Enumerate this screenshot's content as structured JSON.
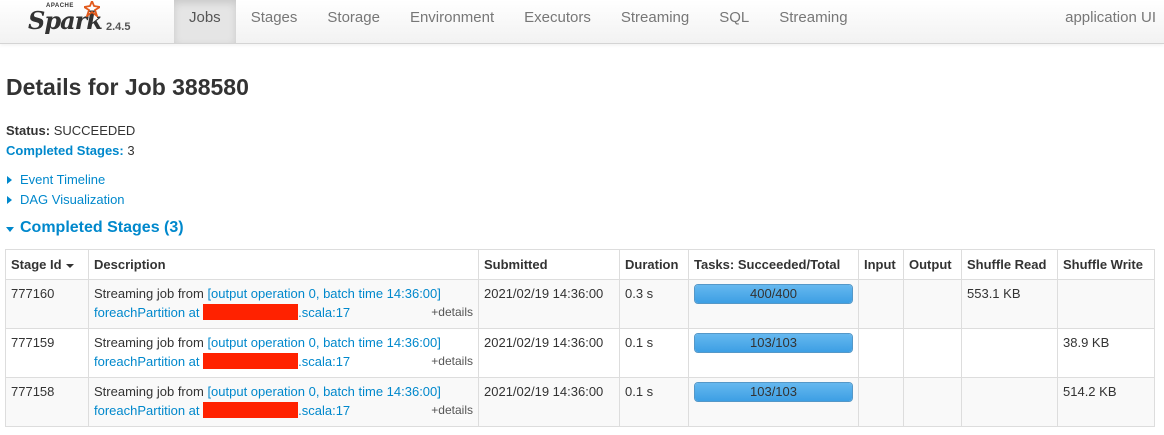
{
  "navbar": {
    "brand": {
      "apache": "APACHE",
      "name": "Spark",
      "version": "2.4.5"
    },
    "tabs": [
      {
        "label": "Jobs",
        "active": true
      },
      {
        "label": "Stages",
        "active": false
      },
      {
        "label": "Storage",
        "active": false
      },
      {
        "label": "Environment",
        "active": false
      },
      {
        "label": "Executors",
        "active": false
      },
      {
        "label": "Streaming",
        "active": false
      },
      {
        "label": "SQL",
        "active": false
      },
      {
        "label": "Streaming",
        "active": false
      }
    ],
    "app_name": "application UI"
  },
  "page": {
    "title": "Details for Job 388580",
    "status_label": "Status:",
    "status_value": "SUCCEEDED",
    "completed_label": "Completed Stages:",
    "completed_value": "3",
    "event_timeline": "Event Timeline",
    "dag_visualization": "DAG Visualization",
    "section_title": "Completed Stages (3)"
  },
  "table": {
    "headers": [
      "Stage Id",
      "Description",
      "Submitted",
      "Duration",
      "Tasks: Succeeded/Total",
      "Input",
      "Output",
      "Shuffle Read",
      "Shuffle Write"
    ],
    "rows": [
      {
        "stage_id": "777160",
        "desc_prefix": "Streaming job from ",
        "desc_link": "[output operation 0, batch time 14:36:00]",
        "desc_line2_prefix": "foreachPartition at ",
        "desc_line2_suffix": ".scala:17",
        "details": "+details",
        "submitted": "2021/02/19 14:36:00",
        "duration": "0.3 s",
        "tasks": "400/400",
        "tasks_fraction": 1.0,
        "input": "",
        "output": "",
        "shuffle_read": "553.1 KB",
        "shuffle_write": ""
      },
      {
        "stage_id": "777159",
        "desc_prefix": "Streaming job from ",
        "desc_link": "[output operation 0, batch time 14:36:00]",
        "desc_line2_prefix": "foreachPartition at ",
        "desc_line2_suffix": ".scala:17",
        "details": "+details",
        "submitted": "2021/02/19 14:36:00",
        "duration": "0.1 s",
        "tasks": "103/103",
        "tasks_fraction": 1.0,
        "input": "",
        "output": "",
        "shuffle_read": "",
        "shuffle_write": "38.9 KB"
      },
      {
        "stage_id": "777158",
        "desc_prefix": "Streaming job from ",
        "desc_link": "[output operation 0, batch time 14:36:00]",
        "desc_line2_prefix": "foreachPartition at ",
        "desc_line2_suffix": ".scala:17",
        "details": "+details",
        "submitted": "2021/02/19 14:36:00",
        "duration": "0.1 s",
        "tasks": "103/103",
        "tasks_fraction": 1.0,
        "input": "",
        "output": "",
        "shuffle_read": "",
        "shuffle_write": "514.2 KB"
      }
    ]
  },
  "colors": {
    "link": "#0088cc",
    "progress_fill": "#3d9fe4",
    "redaction": "#ff2200"
  }
}
